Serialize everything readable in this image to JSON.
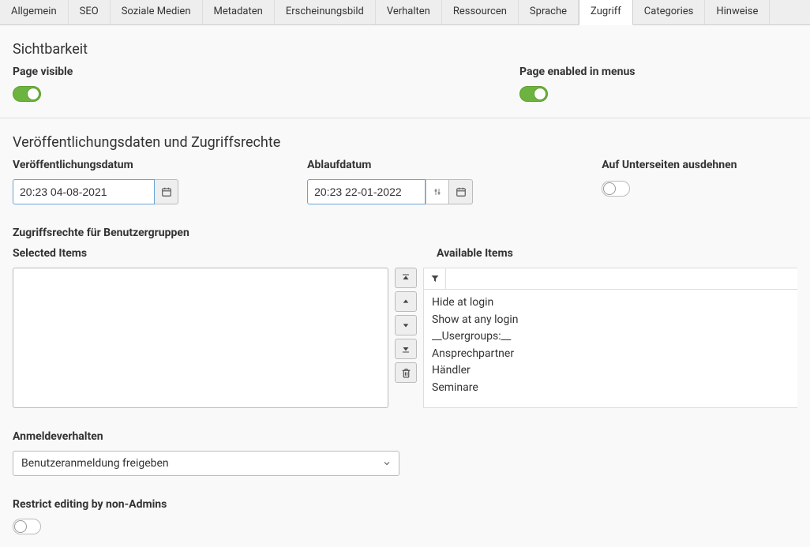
{
  "tabs": [
    "Allgemein",
    "SEO",
    "Soziale Medien",
    "Metadaten",
    "Erscheinungsbild",
    "Verhalten",
    "Ressourcen",
    "Sprache",
    "Zugriff",
    "Categories",
    "Hinweise"
  ],
  "active_tab_index": 8,
  "visibility": {
    "heading": "Sichtbarkeit",
    "page_visible_label": "Page visible",
    "page_visible_on": true,
    "page_enabled_label": "Page enabled in menus",
    "page_enabled_on": true
  },
  "publish": {
    "heading": "Veröffentlichungsdaten und Zugriffsrechte",
    "pub_date_label": "Veröffentlichungsdatum",
    "pub_date_value": "20:23 04-08-2021",
    "exp_date_label": "Ablaufdatum",
    "exp_date_value": "20:23 22-01-2022",
    "extend_label": "Auf Unterseiten ausdehnen",
    "extend_on": false
  },
  "usergroups": {
    "heading": "Zugriffsrechte für Benutzergruppen",
    "selected_label": "Selected Items",
    "available_label": "Available Items",
    "available_items": [
      "Hide at login",
      "Show at any login",
      "__Usergroups:__",
      "Ansprechpartner",
      "Händler",
      "Seminare"
    ]
  },
  "login": {
    "heading": "Anmeldeverhalten",
    "selected_option": "Benutzeranmeldung freigeben"
  },
  "restrict": {
    "label": "Restrict editing by non-Admins",
    "on": false
  }
}
